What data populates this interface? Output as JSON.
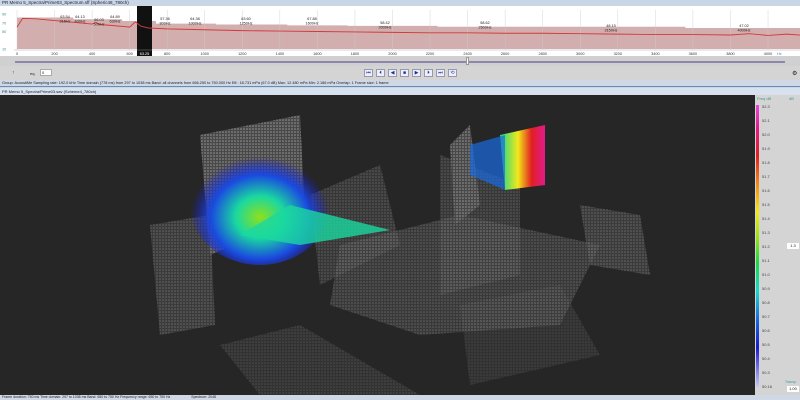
{
  "window": {
    "title": "PR Memo 5_Spectra/Prime03_Spectrum.sff (Spheric48_780ch)"
  },
  "chart_data": {
    "type": "line",
    "xlabel_unit": "Hz",
    "xlim": [
      0,
      4200
    ],
    "ylim": [
      10,
      90
    ],
    "yticks": [
      "90",
      "70",
      "50",
      "10"
    ],
    "xticks": [
      "0",
      "200",
      "400",
      "600",
      "800",
      "1000",
      "1200",
      "1400",
      "1600",
      "1800",
      "2000",
      "2200",
      "2400",
      "2600",
      "2800",
      "3000",
      "3200",
      "3400",
      "3600",
      "3800",
      "4000",
      "4200"
    ],
    "selected_band_label": "63.25",
    "x": [
      0,
      30,
      100,
      200,
      300,
      400,
      420,
      440,
      500,
      600,
      630,
      660,
      700,
      800,
      1000,
      1200,
      1400,
      1600,
      1800,
      2000,
      2200,
      2400,
      2600,
      2800,
      3000,
      3200,
      3400,
      3600,
      3800,
      3900,
      4000,
      4100,
      4200
    ],
    "values": [
      60,
      80,
      79,
      75,
      71,
      67,
      71,
      66,
      64,
      60,
      72,
      62,
      58,
      56,
      54,
      52,
      51,
      50,
      49,
      48,
      47,
      47,
      46,
      46,
      45,
      44,
      43,
      43,
      42,
      45,
      41,
      44,
      41
    ],
    "band_levels": {
      "x": [
        0,
        300,
        560,
        740,
        1060,
        1440,
        1760,
        2240,
        2800,
        3560,
        4200
      ],
      "values": [
        82,
        78,
        74,
        68,
        66,
        64,
        63,
        61,
        61,
        58,
        58
      ]
    },
    "peaks": [
      {
        "value": "63.54",
        "freq": "315Hz"
      },
      {
        "value": "64.13",
        "freq": "400Hz"
      },
      {
        "value": "66.03",
        "freq": "500Hz"
      },
      {
        "value": "64.89",
        "freq": "630Hz"
      },
      {
        "value": "57.36",
        "freq": "800Hz"
      },
      {
        "value": "64.38",
        "freq": "1000Hz"
      },
      {
        "value": "63.60",
        "freq": "1250Hz"
      },
      {
        "value": "67.88",
        "freq": "1600Hz"
      },
      {
        "value": "58.42",
        "freq": "2000Hz"
      },
      {
        "value": "58.62",
        "freq": "2500Hz"
      },
      {
        "value": "48.15",
        "freq": "3150Hz"
      },
      {
        "value": "47.02",
        "freq": "4000Hz"
      }
    ],
    "colors": {
      "line": "#d23a3a",
      "band": "#c89a9a",
      "selected": "#111111",
      "selected_line": "#3ac8b8"
    }
  },
  "controls": {
    "eq_label": "eq.",
    "eq_value": "0",
    "buttons": [
      "skip-start",
      "step-back",
      "rewind",
      "stop",
      "play",
      "step-forward",
      "skip-end",
      "loop"
    ]
  },
  "status": {
    "text": "Group: AcoustiMe  Sampling rate: 192.0 kHz  Time domain (778 ms) from 297 to 1038 ms  Band: all channels from 666.250 to 750.000 Hz  Eff.: 18.731 mPa (67.0 dB)  Max: 12.480 mPa  Min: 2.186 mPa  Overlap: 1  Frame size: 1 frame"
  },
  "viewport": {
    "title": "PR Memo 5_Spectra/Prime03.sav (Scheme4_780ch)"
  },
  "colorbar": {
    "header": "Freq dB",
    "unit": "dB",
    "labels": [
      "52.3",
      "52.1",
      "52.0",
      "51.9",
      "51.8",
      "51.7",
      "51.6",
      "51.5",
      "51.4",
      "51.3",
      "51.2",
      "51.1",
      "51.0",
      "50.9",
      "50.8",
      "50.7",
      "50.6",
      "50.5",
      "50.4",
      "50.3",
      "50.16"
    ],
    "range_value": "1.3",
    "scale_label": "Transp.",
    "scale_value": "1.00"
  },
  "bottom": {
    "text": "Frame duration: 750 ms  Time domain: 297 to 1038 ms  Band: 650 to 750 Hz  Frequency range: 650 to 750 Hz",
    "right": "Spectrum: 2048"
  }
}
